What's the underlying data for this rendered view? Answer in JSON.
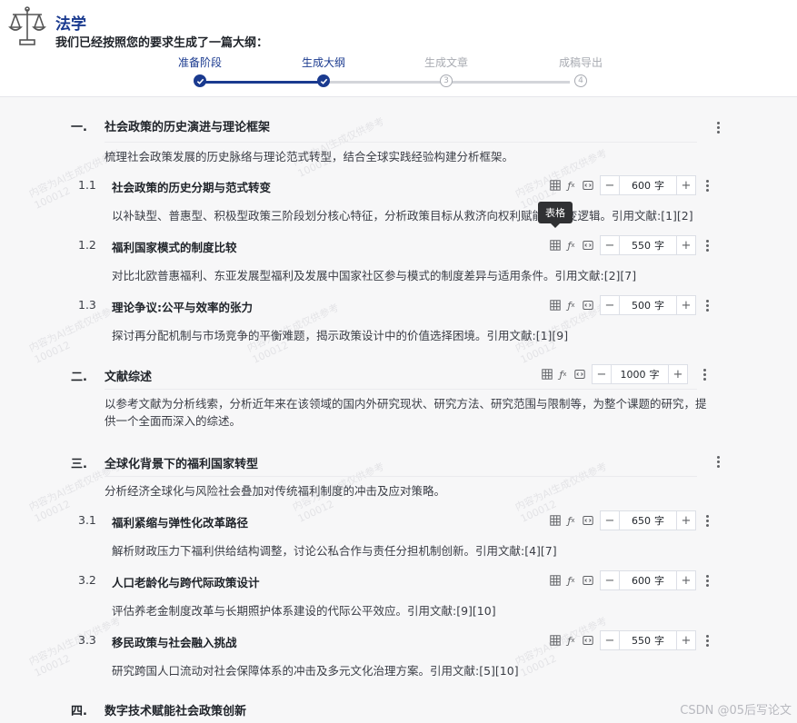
{
  "header": {
    "subject": "法学",
    "subtitle": "我们已经按照您的要求生成了一篇大纲："
  },
  "steps": [
    {
      "label": "准备阶段",
      "num": "1",
      "state": "done"
    },
    {
      "label": "生成大纲",
      "num": "2",
      "state": "done"
    },
    {
      "label": "生成文章",
      "num": "3",
      "state": "todo"
    },
    {
      "label": "成稿导出",
      "num": "4",
      "state": "todo"
    }
  ],
  "tooltip": "表格",
  "unit": "字",
  "sections": [
    {
      "num": "一.",
      "title": "社会政策的历史演进与理论框架",
      "desc": "梳理社会政策发展的历史脉络与理论范式转型，结合全球实践经验构建分析框架。",
      "subs": [
        {
          "num": "1.1",
          "title": "社会政策的历史分期与范式转变",
          "words": "600",
          "desc": "以补缺型、普惠型、积极型政策三阶段划分核心特征，分析政策目标从救济向权利赋能的演变逻辑。引用文献:[1][2]"
        },
        {
          "num": "1.2",
          "title": "福利国家模式的制度比较",
          "words": "550",
          "desc": "对比北欧普惠福利、东亚发展型福利及发展中国家社区参与模式的制度差异与适用条件。引用文献:[2][7]"
        },
        {
          "num": "1.3",
          "title": "理论争议:公平与效率的张力",
          "words": "500",
          "desc": "探讨再分配机制与市场竞争的平衡难题，揭示政策设计中的价值选择困境。引用文献:[1][9]"
        }
      ]
    },
    {
      "num": "二.",
      "title": "文献综述",
      "words": "1000",
      "desc": "以参考文献为分析线索，分析近年来在该领域的国内外研究现状、研究方法、研究范围与限制等，为整个课题的研究，提供一个全面而深入的综述。"
    },
    {
      "num": "三.",
      "title": "全球化背景下的福利国家转型",
      "desc": "分析经济全球化与风险社会叠加对传统福利制度的冲击及应对策略。",
      "subs": [
        {
          "num": "3.1",
          "title": "福利紧缩与弹性化改革路径",
          "words": "650",
          "desc": "解析财政压力下福利供给结构调整，讨论公私合作与责任分担机制创新。引用文献:[4][7]"
        },
        {
          "num": "3.2",
          "title": "人口老龄化与跨代际政策设计",
          "words": "600",
          "desc": "评估养老金制度改革与长期照护体系建设的代际公平效应。引用文献:[9][10]"
        },
        {
          "num": "3.3",
          "title": "移民政策与社会融入挑战",
          "words": "550",
          "desc": "研究跨国人口流动对社会保障体系的冲击及多元文化治理方案。引用文献:[5][10]"
        }
      ]
    },
    {
      "num": "四.",
      "title": "数字技术赋能社会政策创新"
    }
  ],
  "watermark": {
    "line1": "内容为AI生成仅供参考",
    "line2": "100012"
  },
  "footer": "CSDN @05后写论文",
  "colors": {
    "accent": "#1a3a8f",
    "muted": "#a8abb2"
  }
}
